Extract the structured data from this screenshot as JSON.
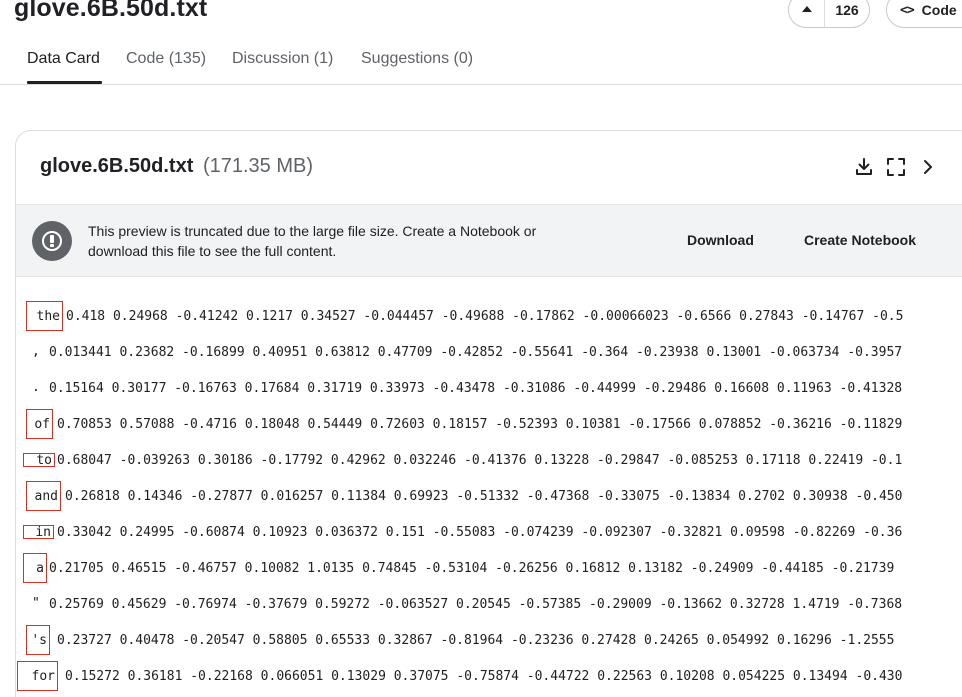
{
  "page": {
    "title": "glove.6B.50d.txt"
  },
  "vote": {
    "count": "126",
    "icon": "upvote-icon"
  },
  "code_button": {
    "icon": "<>",
    "label": "Code"
  },
  "tabs": [
    {
      "label": "Data Card",
      "active": true
    },
    {
      "label": "Code (135)",
      "active": false
    },
    {
      "label": "Discussion (1)",
      "active": false
    },
    {
      "label": "Suggestions (0)",
      "active": false
    }
  ],
  "file": {
    "name": "glove.6B.50d.txt",
    "size": "(171.35 MB)"
  },
  "header_icons": [
    "download-icon",
    "fullscreen-icon",
    "chevron-right-icon"
  ],
  "banner": {
    "message": "This preview is truncated due to the large file size. Create a Notebook or download this file to see the full content.",
    "download_label": "Download",
    "create_notebook_label": "Create Notebook",
    "icon": "info-icon"
  },
  "rows": [
    {
      "token": "the",
      "values": "0.418 0.24968 -0.41242 0.1217 0.34527 -0.044457 -0.49688 -0.17862 -0.00066023 -0.6566 0.27843 -0.14767 -0.5"
    },
    {
      "token": ",",
      "values": "0.013441 0.23682 -0.16899 0.40951 0.63812 0.47709 -0.42852 -0.55641 -0.364 -0.23938 0.13001 -0.063734 -0.3957"
    },
    {
      "token": ".",
      "values": "0.15164 0.30177 -0.16763 0.17684 0.31719 0.33973 -0.43478 -0.31086 -0.44999 -0.29486 0.16608 0.11963 -0.41328"
    },
    {
      "token": "of",
      "values": "0.70853 0.57088 -0.4716 0.18048 0.54449 0.72603 0.18157 -0.52393 0.10381 -0.17566 0.078852 -0.36216 -0.11829"
    },
    {
      "token": "to",
      "values": "0.68047 -0.039263 0.30186 -0.17792 0.42962 0.032246 -0.41376 0.13228 -0.29847 -0.085253 0.17118 0.22419 -0.1"
    },
    {
      "token": "and",
      "values": "0.26818 0.14346 -0.27877 0.016257 0.11384 0.69923 -0.51332 -0.47368 -0.33075 -0.13834 0.2702 0.30938 -0.450"
    },
    {
      "token": "in",
      "values": "0.33042 0.24995 -0.60874 0.10923 0.036372 0.151 -0.55083 -0.074239 -0.092307 -0.32821 0.09598 -0.82269 -0.36"
    },
    {
      "token": "a",
      "values": "0.21705 0.46515 -0.46757 0.10082 1.0135 0.74845 -0.53104 -0.26256 0.16812 0.13182 -0.24909 -0.44185 -0.21739"
    },
    {
      "token": "\"",
      "values": "0.25769 0.45629 -0.76974 -0.37679 0.59272 -0.063527 0.20545 -0.57385 -0.29009 -0.13662 0.32728 1.4719 -0.7368"
    },
    {
      "token": "'s",
      "values": "0.23727 0.40478 -0.20547 0.58805 0.65533 0.32867 -0.81964 -0.23236 0.27428 0.24265 0.054992 0.16296 -1.2555"
    },
    {
      "token": "for",
      "values": "0.15272 0.36181 -0.22168 0.066051 0.13029 0.37075 -0.75874 -0.44722 0.22563 0.10208 0.054225 0.13494 -0.430"
    }
  ],
  "colors": {
    "highlight_border": "#d93025",
    "banner_bg": "#f1f3f4",
    "info_icon_bg": "#5f6368"
  }
}
